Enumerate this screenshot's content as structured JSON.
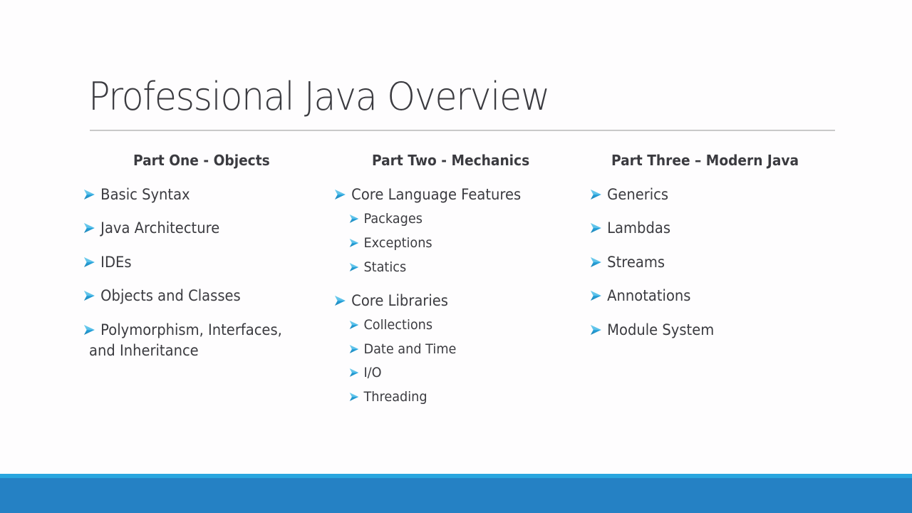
{
  "slide": {
    "title": "Professional Java Overview",
    "accent_color": "#29a6df",
    "footer_color": "#2581c4",
    "bullet_icon": "arrow-bullet-icon",
    "columns": [
      {
        "heading": "Part One - Objects",
        "items": [
          {
            "label": "Basic Syntax"
          },
          {
            "label": "Java Architecture"
          },
          {
            "label": "IDEs"
          },
          {
            "label": "Objects and Classes"
          },
          {
            "label": "Polymorphism, Interfaces,",
            "continuation": "and Inheritance"
          }
        ]
      },
      {
        "heading": "Part Two - Mechanics",
        "items": [
          {
            "label": "Core Language Features",
            "children": [
              "Packages",
              "Exceptions",
              "Statics"
            ]
          },
          {
            "label": "Core Libraries",
            "children": [
              "Collections",
              "Date and Time",
              "I/O",
              "Threading"
            ]
          }
        ]
      },
      {
        "heading": "Part Three – Modern Java",
        "items": [
          {
            "label": "Generics"
          },
          {
            "label": "Lambdas"
          },
          {
            "label": "Streams"
          },
          {
            "label": "Annotations"
          },
          {
            "label": "Module System"
          }
        ]
      }
    ]
  }
}
